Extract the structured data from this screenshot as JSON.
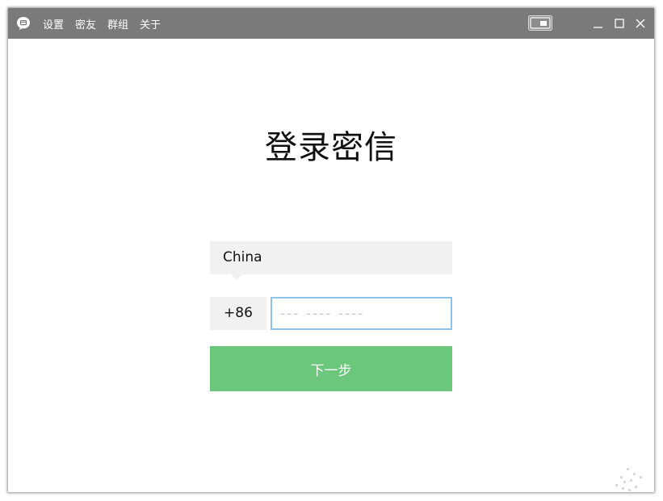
{
  "titlebar": {
    "menu": [
      {
        "id": "settings",
        "label": "设置"
      },
      {
        "id": "friends",
        "label": "密友"
      },
      {
        "id": "groups",
        "label": "群组"
      },
      {
        "id": "about",
        "label": "关于"
      }
    ],
    "icons": {
      "app": "chat-bubble-icon",
      "mini_mode": "mini-mode-icon",
      "minimize": "minimize-icon",
      "maximize": "maximize-icon",
      "close": "close-icon"
    }
  },
  "login": {
    "title": "登录密信",
    "country": "China",
    "dial_code": "+86",
    "phone_value": "",
    "phone_placeholder": "--- ---- ----",
    "next_label": "下一步"
  },
  "colors": {
    "titlebar_bg": "#7a7a7a",
    "field_bg": "#f1f1f1",
    "focus_border": "#8ac4ea",
    "primary_button": "#6bc77c"
  }
}
